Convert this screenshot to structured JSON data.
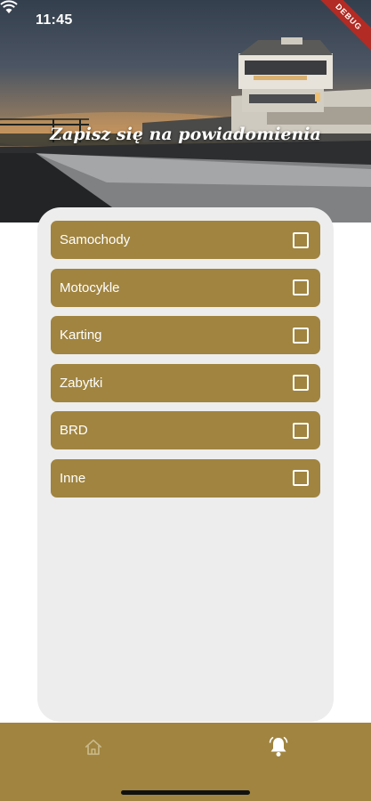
{
  "status_bar": {
    "time": "11:45",
    "debug_label": "DEBUG"
  },
  "hero": {
    "title": "Zapisz się na powiadomienia"
  },
  "categories": [
    {
      "label": "Samochody",
      "checked": false
    },
    {
      "label": "Motocykle",
      "checked": false
    },
    {
      "label": "Karting",
      "checked": false
    },
    {
      "label": "Zabytki",
      "checked": false
    },
    {
      "label": "BRD",
      "checked": false
    },
    {
      "label": "Inne",
      "checked": false
    }
  ],
  "bottom_nav": {
    "items": [
      {
        "icon": "home-icon",
        "active": false
      },
      {
        "icon": "bell-icon",
        "active": true
      }
    ]
  },
  "colors": {
    "accent": "#a08440",
    "panel": "#ededed",
    "inactive_icon": "#c9b98a",
    "active_icon": "#ffffff"
  }
}
